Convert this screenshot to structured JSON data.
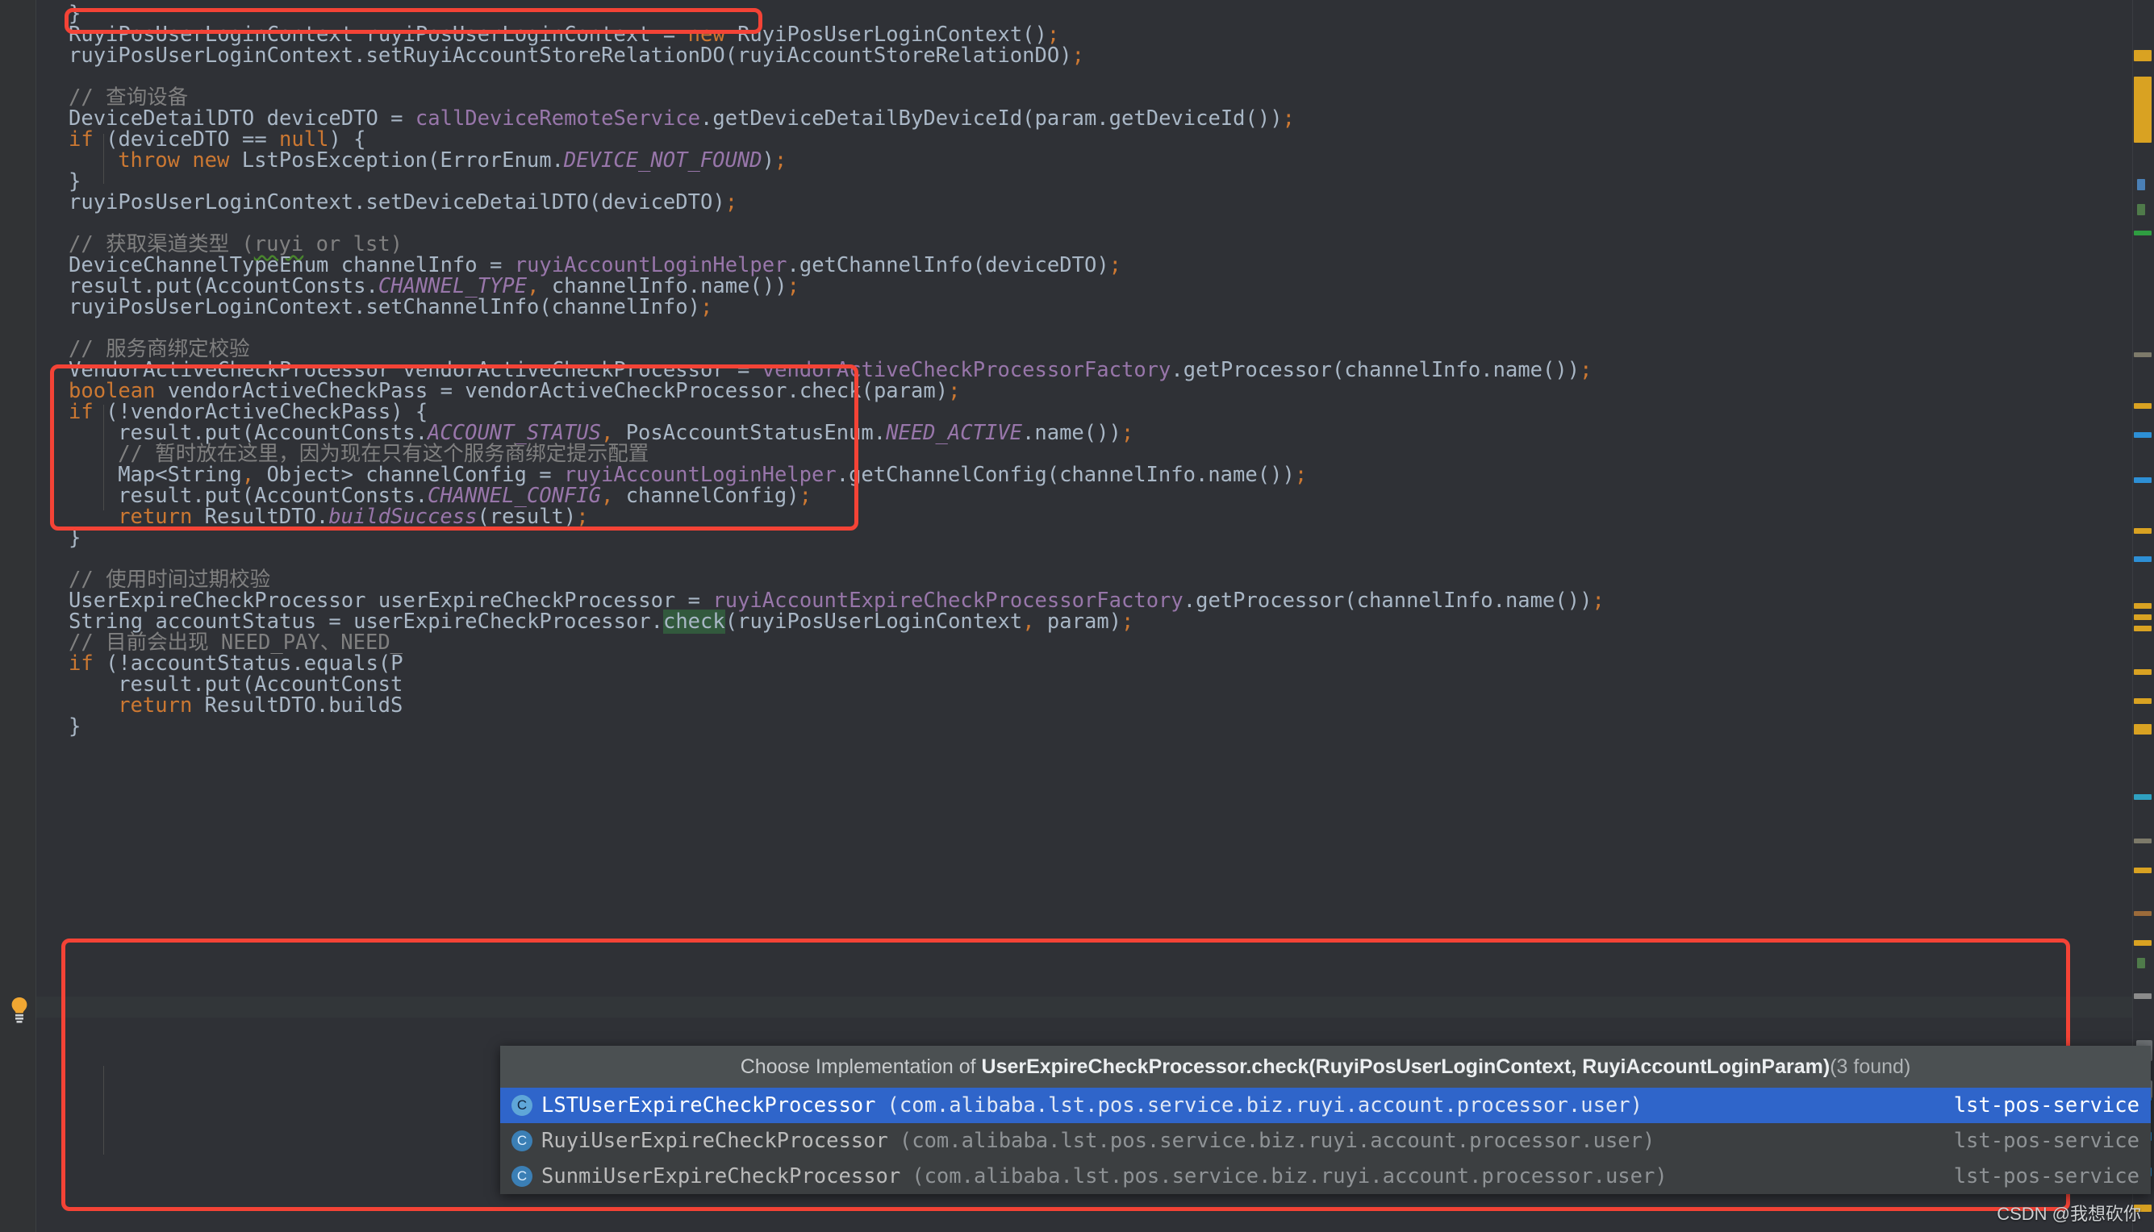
{
  "editor": {
    "background": "#2f3136",
    "accent_red": "#f44336",
    "selection_blue": "#2f65ca",
    "lines": [
      {
        "indent": 0,
        "text": "}"
      },
      {
        "indent": 0,
        "text": "RuyiPosUserLoginContext ruyiPosUserLoginContext = new RuyiPosUserLoginContext();"
      },
      {
        "indent": 0,
        "text": "ruyiPosUserLoginContext.setRuyiAccountStoreRelationDO(ruyiAccountStoreRelationDO);"
      },
      {
        "indent": 0,
        "text": ""
      },
      {
        "indent": 0,
        "text": "// 查询设备"
      },
      {
        "indent": 0,
        "text": "DeviceDetailDTO deviceDTO = callDeviceRemoteService.getDeviceDetailByDeviceId(param.getDeviceId());"
      },
      {
        "indent": 0,
        "text": "if (deviceDTO == null) {"
      },
      {
        "indent": 1,
        "text": "throw new LstPosException(ErrorEnum.DEVICE_NOT_FOUND);"
      },
      {
        "indent": 0,
        "text": "}"
      },
      {
        "indent": 0,
        "text": "ruyiPosUserLoginContext.setDeviceDetailDTO(deviceDTO);"
      },
      {
        "indent": 0,
        "text": ""
      },
      {
        "indent": 0,
        "text": "// 获取渠道类型 (ruyi or lst)"
      },
      {
        "indent": 0,
        "text": "DeviceChannelTypeEnum channelInfo = ruyiAccountLoginHelper.getChannelInfo(deviceDTO);"
      },
      {
        "indent": 0,
        "text": "result.put(AccountConsts.CHANNEL_TYPE, channelInfo.name());"
      },
      {
        "indent": 0,
        "text": "ruyiPosUserLoginContext.setChannelInfo(channelInfo);"
      },
      {
        "indent": 0,
        "text": ""
      },
      {
        "indent": 0,
        "text": "// 服务商绑定校验"
      },
      {
        "indent": 0,
        "text": "VendorActiveCheckProcessor vendorActiveCheckProcessor = vendorActiveCheckProcessorFactory.getProcessor(channelInfo.name());"
      },
      {
        "indent": 0,
        "text": "boolean vendorActiveCheckPass = vendorActiveCheckProcessor.check(param);"
      },
      {
        "indent": 0,
        "text": "if (!vendorActiveCheckPass) {"
      },
      {
        "indent": 1,
        "text": "result.put(AccountConsts.ACCOUNT_STATUS, PosAccountStatusEnum.NEED_ACTIVE.name());"
      },
      {
        "indent": 1,
        "text": "// 暂时放在这里，因为现在只有这个服务商绑定提示配置"
      },
      {
        "indent": 1,
        "text": "Map<String, Object> channelConfig = ruyiAccountLoginHelper.getChannelConfig(channelInfo.name());"
      },
      {
        "indent": 1,
        "text": "result.put(AccountConsts.CHANNEL_CONFIG, channelConfig);"
      },
      {
        "indent": 1,
        "text": "return ResultDTO.buildSuccess(result);"
      },
      {
        "indent": 0,
        "text": "}"
      },
      {
        "indent": 0,
        "text": ""
      },
      {
        "indent": 0,
        "text": "// 使用时间过期校验"
      },
      {
        "indent": 0,
        "text": "UserExpireCheckProcessor userExpireCheckProcessor = ruyiAccountExpireCheckProcessorFactory.getProcessor(channelInfo.name());"
      },
      {
        "indent": 0,
        "text": "String accountStatus = userExpireCheckProcessor.check(ruyiPosUserLoginContext, param);"
      },
      {
        "indent": 0,
        "text": "// 目前会出现 NEED_PAY、NEED_"
      },
      {
        "indent": 0,
        "text": "if (!accountStatus.equals(P"
      },
      {
        "indent": 1,
        "text": "result.put(AccountConst"
      },
      {
        "indent": 1,
        "text": "return ResultDTO.buildS"
      },
      {
        "indent": 0,
        "text": "}"
      }
    ]
  },
  "gutter": {
    "bulb_icon": "lightbulb-icon"
  },
  "popup": {
    "title_prefix": "Choose Implementation of ",
    "title_signature": "UserExpireCheckProcessor.check(RuyiPosUserLoginContext, RuyiAccountLoginParam)",
    "title_count": "(3 found)",
    "class_icon_letter": "C",
    "items": [
      {
        "class_name": "LSTUserExpireCheckProcessor",
        "package": "(com.alibaba.lst.pos.service.biz.ruyi.account.processor.user)",
        "module": "lst-pos-service",
        "selected": true
      },
      {
        "class_name": "RuyiUserExpireCheckProcessor",
        "package": "(com.alibaba.lst.pos.service.biz.ruyi.account.processor.user)",
        "module": "lst-pos-service",
        "selected": false
      },
      {
        "class_name": "SunmiUserExpireCheckProcessor",
        "package": "(com.alibaba.lst.pos.service.biz.ruyi.account.processor.user)",
        "module": "lst-pos-service",
        "selected": false
      }
    ]
  },
  "watermark": {
    "text": "CSDN @我想砍你"
  },
  "annotations": {
    "box_1_label": "highlight-box-context-creation",
    "box_2_label": "highlight-box-channel-type",
    "box_3_label": "highlight-box-expire-check"
  }
}
